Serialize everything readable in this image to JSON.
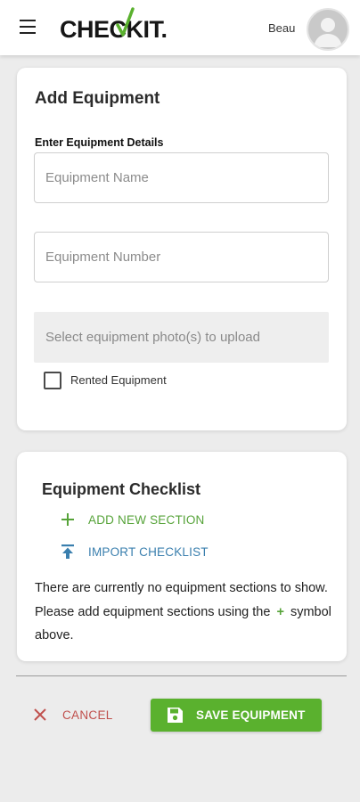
{
  "header": {
    "logo_text": "CHECKIT.",
    "username": "Beau",
    "icons": {
      "menu": "hamburger-menu-icon",
      "avatar": "user-avatar-icon"
    }
  },
  "add_equipment": {
    "title": "Add Equipment",
    "section_label": "Enter Equipment Details",
    "name_placeholder": "Equipment Name",
    "name_value": "",
    "number_placeholder": "Equipment Number",
    "number_value": "",
    "upload_label": "Select equipment photo(s) to upload",
    "rented_label": "Rented Equipment",
    "rented_checked": false
  },
  "checklist": {
    "title": "Equipment Checklist",
    "add_section_label": "ADD NEW SECTION",
    "import_label": "IMPORT CHECKLIST",
    "empty_message_before": "There are currently no equipment sections to show. Please add equipment sections using the",
    "empty_message_symbol": "+",
    "empty_message_after": "symbol above."
  },
  "footer": {
    "cancel_label": "CANCEL",
    "save_label": "SAVE EQUIPMENT"
  },
  "colors": {
    "accent_green": "#5ab12e",
    "link_green": "#56a339",
    "link_blue": "#3a7fae",
    "cancel_red": "#c0504d",
    "background": "#ececec"
  }
}
